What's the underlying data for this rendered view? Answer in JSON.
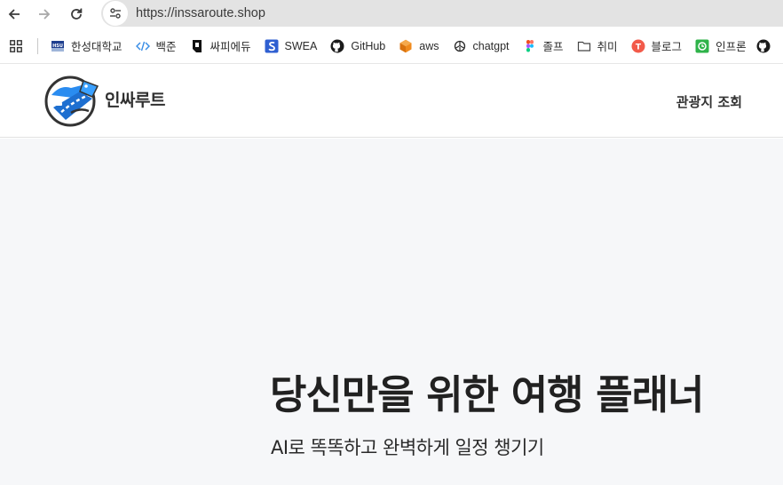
{
  "browser": {
    "url": "https://inssaroute.shop",
    "bookmarks": [
      {
        "label": "한성대학교",
        "icon": "hansung-icon"
      },
      {
        "label": "백준",
        "icon": "code-icon"
      },
      {
        "label": "싸피에듀",
        "icon": "ssafy-icon"
      },
      {
        "label": "SWEA",
        "icon": "swea-icon"
      },
      {
        "label": "GitHub",
        "icon": "github-icon"
      },
      {
        "label": "aws",
        "icon": "aws-icon"
      },
      {
        "label": "chatgpt",
        "icon": "chatgpt-icon"
      },
      {
        "label": "졸프",
        "icon": "figma-icon"
      },
      {
        "label": "취미",
        "icon": "folder-icon"
      },
      {
        "label": "블로그",
        "icon": "blog-icon"
      },
      {
        "label": "인프론",
        "icon": "inflearn-icon"
      }
    ]
  },
  "site": {
    "logo_text": "인싸루트",
    "nav": {
      "attractions": "관광지 조회"
    }
  },
  "hero": {
    "title": "당신만을 위한 여행 플래너",
    "subtitle": "AI로 똑똑하고 완벽하게 일정 챙기기"
  }
}
